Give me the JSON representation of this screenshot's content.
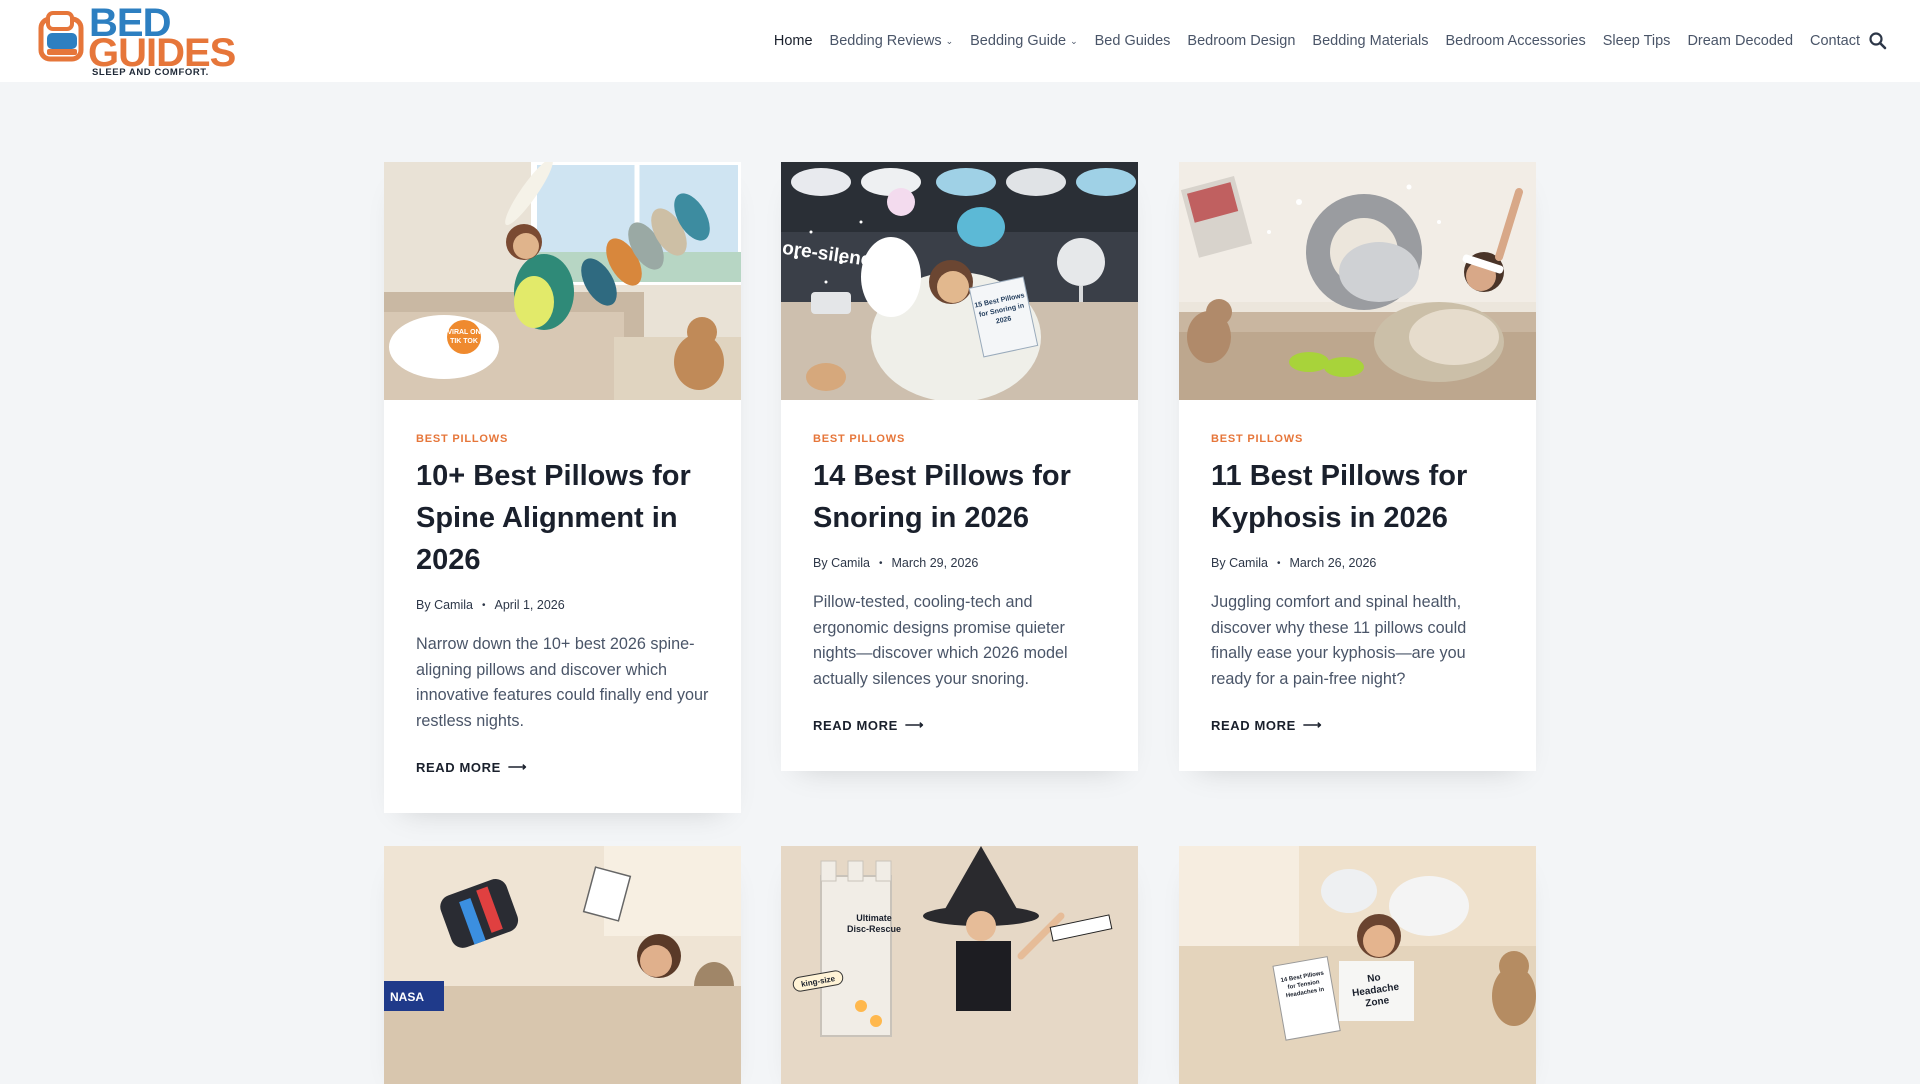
{
  "brand": {
    "line1": "BED",
    "line2": "GUIDES",
    "tagline": "SLEEP AND COMFORT."
  },
  "nav": {
    "items": [
      {
        "label": "Home",
        "active": true
      },
      {
        "label": "Bedding Reviews",
        "has_dropdown": true
      },
      {
        "label": "Bedding Guide",
        "has_dropdown": true
      },
      {
        "label": "Bed Guides"
      },
      {
        "label": "Bedroom Design"
      },
      {
        "label": "Bedding Materials"
      },
      {
        "label": "Bedroom Accessories"
      },
      {
        "label": "Sleep Tips"
      },
      {
        "label": "Dream Decoded"
      },
      {
        "label": "Contact"
      }
    ],
    "search_icon": "search-icon"
  },
  "posts": [
    {
      "category": "BEST PILLOWS",
      "title": "10+ Best Pillows for Spine Alignment in 2026",
      "by": "By",
      "author": "Camila",
      "date": "April 1, 2026",
      "excerpt": "Narrow down the 10+ best 2026 spine-aligning pillows and discover which innovative features could finally end your restless nights.",
      "read_more": "READ MORE",
      "image_badge": "VIRAL ON TIK TOK"
    },
    {
      "category": "BEST PILLOWS",
      "title": "14 Best Pillows for Snoring in 2026",
      "by": "By",
      "author": "Camila",
      "date": "March 29, 2026",
      "excerpt": "Pillow-tested, cooling-tech and ergonomic designs promise quieter nights—discover which 2026 model actually silences your snoring.",
      "read_more": "READ MORE",
      "image_caption": "more-silencing",
      "image_book": "15 Best Pillows for Snoring in 2026"
    },
    {
      "category": "BEST PILLOWS",
      "title": "11 Best Pillows for Kyphosis in 2026",
      "by": "By",
      "author": "Camila",
      "date": "March 26, 2026",
      "excerpt": "Juggling comfort and spinal health, discover why these 11 pillows could finally ease your kyphosis—are you ready for a pain-free night?",
      "read_more": "READ MORE"
    },
    {
      "image_badge": "NASA"
    },
    {
      "image_label_1": "Ultimate Disc-Rescue",
      "image_label_2": "king-size"
    },
    {
      "image_book": "14 Best Pillows for Tension Headaches in",
      "image_shirt": "No Headache Zone"
    }
  ],
  "colors": {
    "accent": "#e6763a",
    "brand_blue": "#2d7fc1",
    "page_bg": "#f3f5f7"
  }
}
